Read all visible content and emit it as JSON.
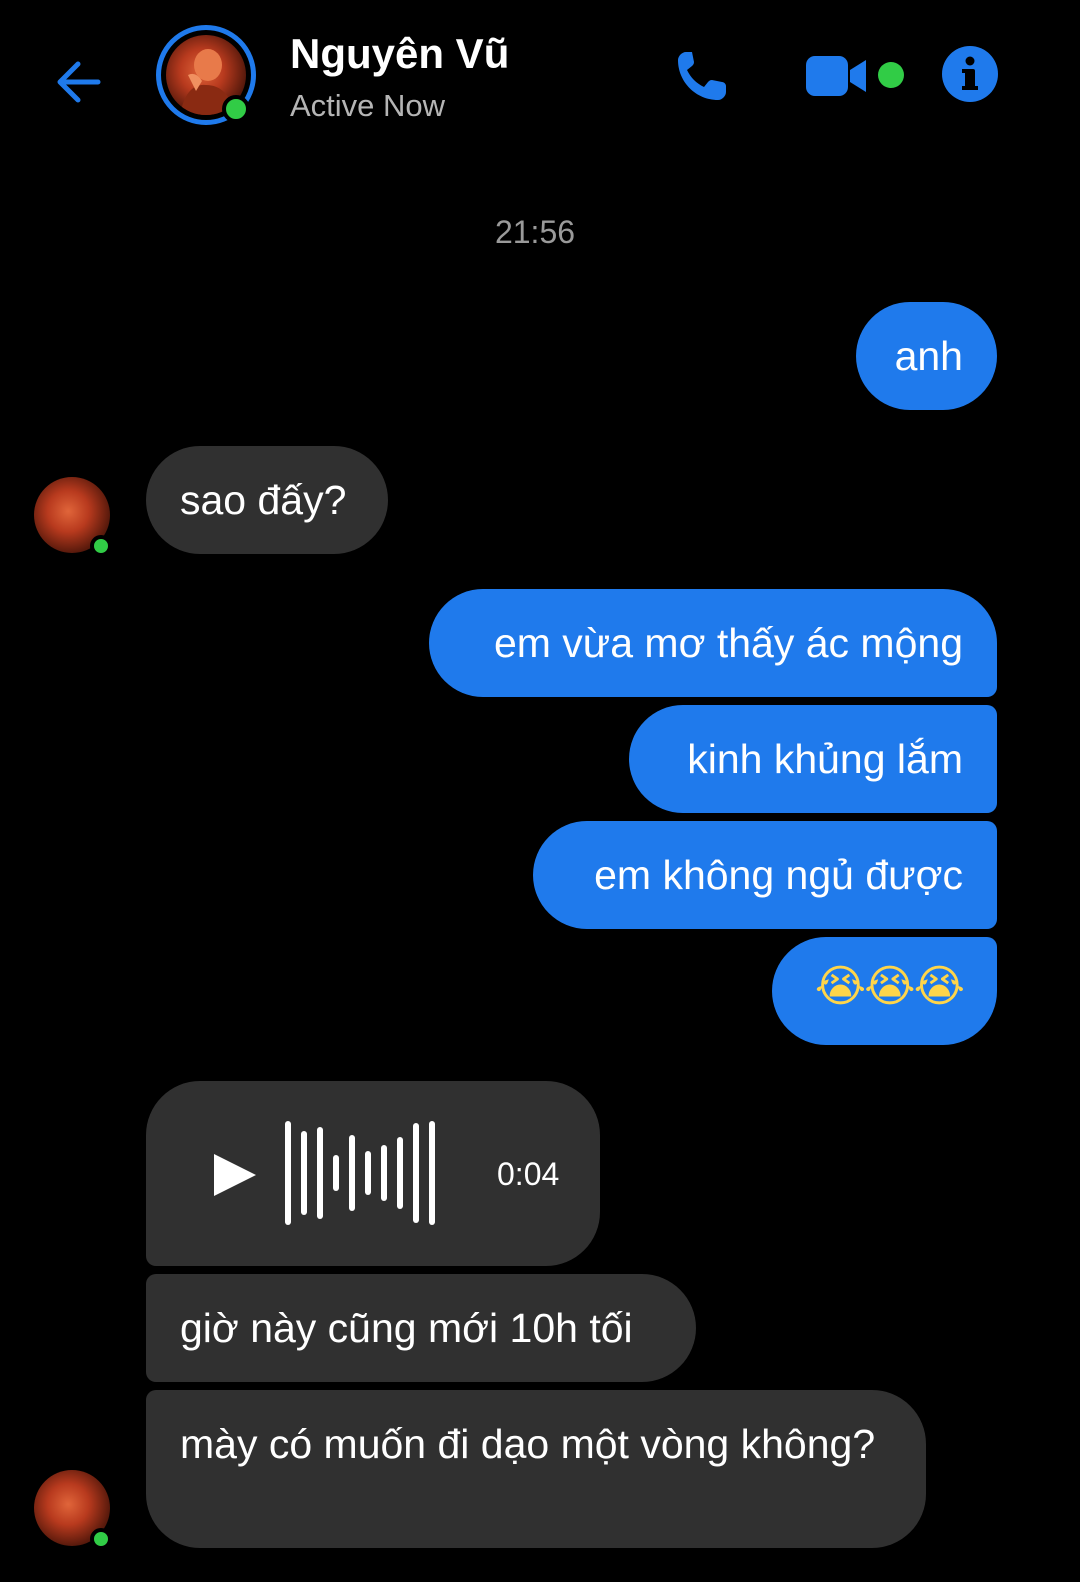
{
  "header": {
    "contact_name": "Nguyên Vũ",
    "status": "Active Now",
    "icons": [
      "back-arrow-icon",
      "phone-icon",
      "video-camera-icon",
      "info-icon"
    ]
  },
  "timestamp": "21:56",
  "messages": [
    {
      "from": "me",
      "text": "anh"
    },
    {
      "from": "them",
      "text": "sao đấy?"
    },
    {
      "from": "me",
      "text": "em vừa mơ thấy ác mộng"
    },
    {
      "from": "me",
      "text": "kinh khủng lắm"
    },
    {
      "from": "me",
      "text": "em không ngủ được"
    },
    {
      "from": "me",
      "text": "😭😭😭"
    },
    {
      "from": "them",
      "type": "voice",
      "duration": "0:04"
    },
    {
      "from": "them",
      "text": "giờ này cũng mới 10h tối"
    },
    {
      "from": "them",
      "text": "mày có muốn đi dạo một vòng không?"
    }
  ],
  "colors": {
    "accent": "#1f7aec",
    "received_bubble": "#303030",
    "online": "#31cc46",
    "background": "#000000"
  }
}
